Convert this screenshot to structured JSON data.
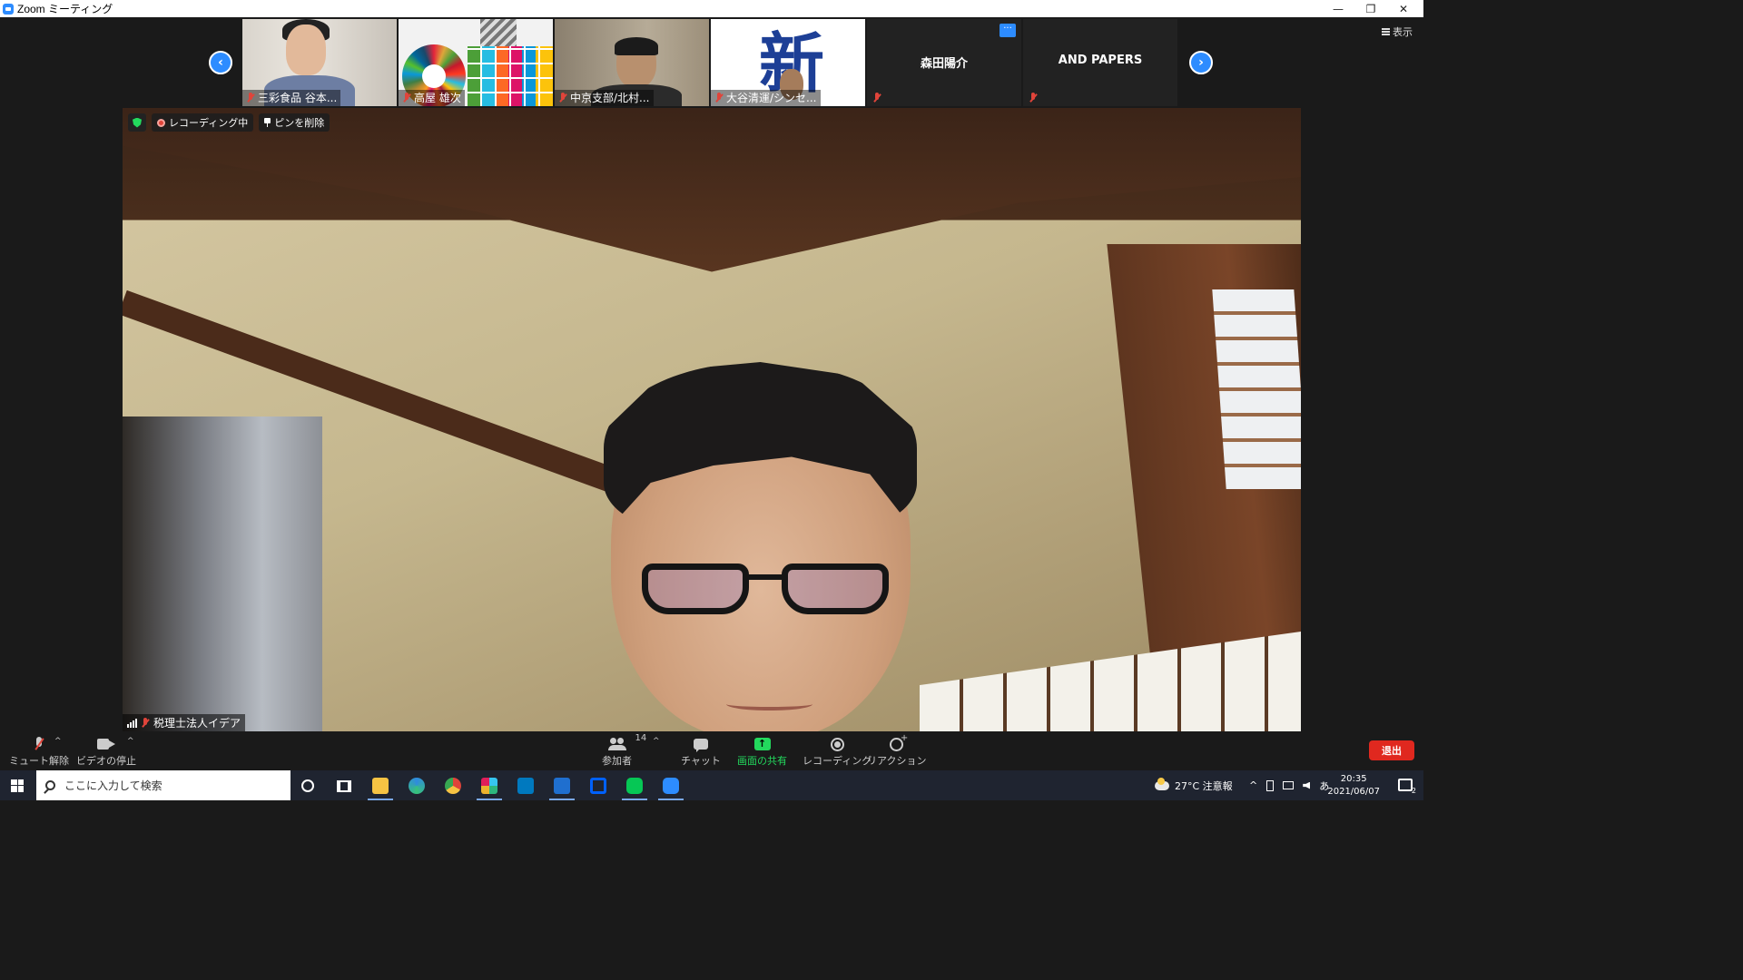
{
  "window": {
    "title": "Zoom ミーティング",
    "minimize": "—",
    "restore": "❐",
    "close": "✕"
  },
  "view_button": {
    "label": "表示"
  },
  "gallery": {
    "prev": "‹",
    "next": "›",
    "tiles": [
      {
        "name": "三彩食品  谷本..."
      },
      {
        "name": "高屋 雄次"
      },
      {
        "name": "中京支部/北村..."
      },
      {
        "name": "大谷清運/シンセ..."
      },
      {
        "name": "森田陽介"
      },
      {
        "name": "AND PAPERS"
      }
    ],
    "more_label": "···"
  },
  "main_video": {
    "recording_label": "レコーディング中",
    "unpin_label": "ピンを削除",
    "speaker_name": "税理士法人イデア"
  },
  "toolbar": {
    "mute_label": "ミュート解除",
    "video_label": "ビデオの停止",
    "participants_label": "参加者",
    "participants_count": "14",
    "chat_label": "チャット",
    "share_label": "画面の共有",
    "record_label": "レコーディング",
    "reaction_label": "リアクション",
    "leave_label": "退出",
    "caret": "^",
    "share_glyph": "↑"
  },
  "taskbar": {
    "search_placeholder": "ここに入力して検索",
    "weather": "27°C  注意報",
    "tray_ime": "あ",
    "tray_chevron": "^",
    "time": "20:35",
    "date": "2021/06/07",
    "notif_count": "2"
  },
  "colors": {
    "accent": "#2d8cff",
    "share_green": "#23d95d",
    "leave_red": "#e0281f",
    "muted_red": "#e0443a"
  }
}
